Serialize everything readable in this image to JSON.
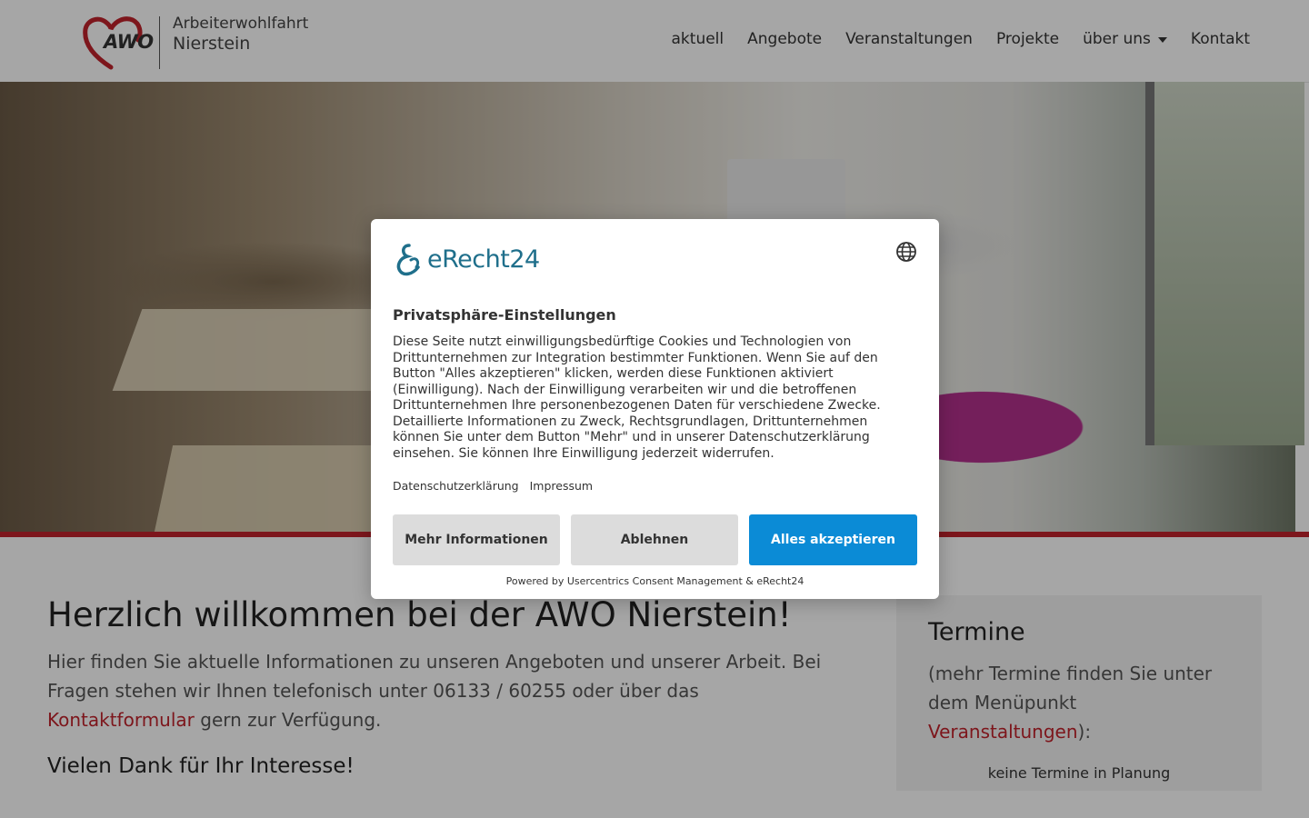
{
  "header": {
    "logo": {
      "mark": "AWO",
      "line1": "Arbeiterwohlfahrt",
      "line2": "Nierstein"
    },
    "nav": [
      {
        "label": "aktuell"
      },
      {
        "label": "Angebote"
      },
      {
        "label": "Veranstaltungen"
      },
      {
        "label": "Projekte"
      },
      {
        "label": "über uns",
        "has_dropdown": true
      },
      {
        "label": "Kontakt"
      }
    ]
  },
  "main": {
    "title": "Herzlich willkommen bei der AWO Nierstein!",
    "intro_part1": "Hier finden Sie aktuelle Informationen zu unseren Angeboten und unserer Arbeit. Bei Fragen stehen wir Ihnen telefonisch unter 06133 / 60255 oder über das ",
    "intro_link": "Kontaktformular",
    "intro_part2": " gern zur Verfügung.",
    "thanks": "Vielen Dank für Ihr Interesse!"
  },
  "aside": {
    "title": "Termine",
    "text_part1": "(mehr Termine finden Sie unter dem Menüpunkt ",
    "text_link": "Veranstaltungen",
    "text_part2": "):",
    "note": "keine Termine in Planung"
  },
  "consent": {
    "brand": "eRecht24",
    "title": "Privatsphäre-Einstellungen",
    "body": "Diese Seite nutzt einwilligungsbedürftige Cookies und Technologien von Drittunternehmen zur Integration bestimmter Funktionen. Wenn Sie auf den Button \"Alles akzeptieren\" klicken, werden diese Funktionen aktiviert (Einwilligung). Nach der Einwilligung verarbeiten wir und die betroffenen Drittunternehmen Ihre personenbezogenen Daten für verschiedene Zwecke. Detaillierte Informationen zu Zweck, Rechtsgrundlagen, Drittunternehmen können Sie unter dem Button \"Mehr\" und in unserer Datenschutzerklärung einsehen. Sie können Ihre Einwilligung jederzeit widerrufen.",
    "links": [
      "Datenschutzerklärung",
      "Impressum"
    ],
    "buttons": {
      "more": "Mehr Informationen",
      "deny": "Ablehnen",
      "accept": "Alles akzeptieren"
    },
    "powered_by": "Powered by Usercentrics Consent Management & eRecht24"
  },
  "colors": {
    "accent_red": "#c0232c",
    "accept_blue": "#0b8bd6",
    "brand_teal": "#1f6f8b"
  }
}
